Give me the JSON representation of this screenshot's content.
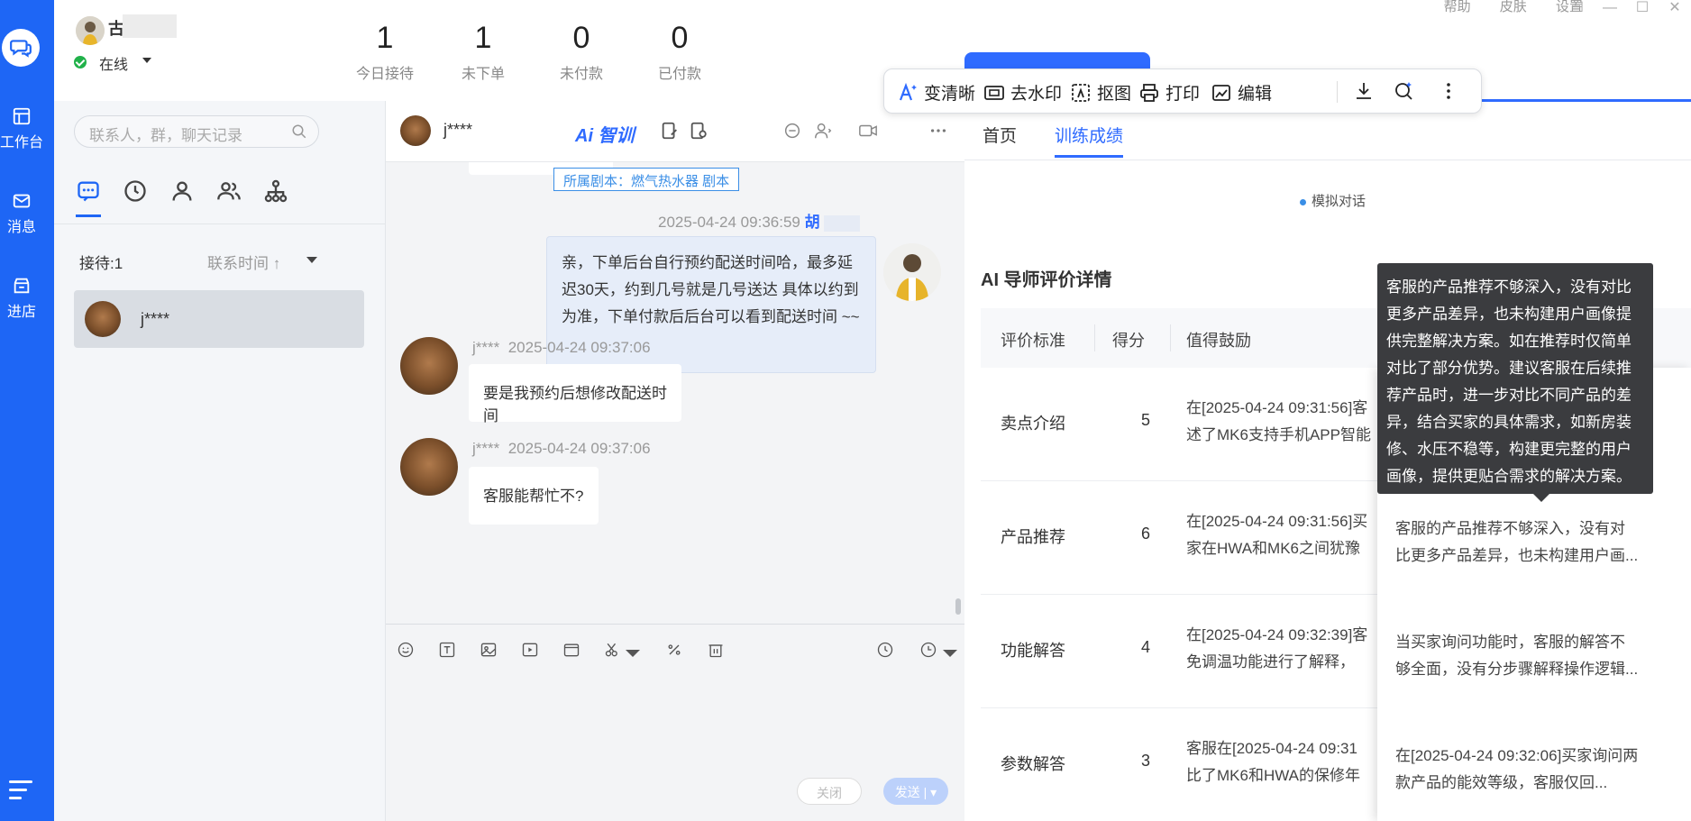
{
  "rail": {
    "items": [
      {
        "label": "工作台"
      },
      {
        "label": "消息"
      },
      {
        "label": "进店"
      }
    ]
  },
  "header": {
    "user_initial": "古",
    "status": "在线",
    "stats": [
      {
        "value": "1",
        "label": "今日接待"
      },
      {
        "value": "1",
        "label": "未下单"
      },
      {
        "value": "0",
        "label": "未付款"
      },
      {
        "value": "0",
        "label": "已付款"
      }
    ],
    "links": [
      "帮助",
      "皮肤",
      "设置"
    ]
  },
  "contacts": {
    "search_placeholder": "联系人，群，聊天记录",
    "queue_label": "接待:1",
    "sort_label": "联系时间 ↑",
    "items": [
      {
        "name": "j****"
      }
    ]
  },
  "chat": {
    "contact_name": "j****",
    "ai_label": "Ai 智训",
    "script_tag": "所属剧本：燃气热水器  剧本",
    "messages": [
      {
        "time": "2025-04-24 09:36:59",
        "sender": "胡",
        "text": "亲，下单后台自行预约配送时间哈，最多延迟30天，约到几号就是几号送达 具体以约到为准，下单付款后后台可以看到配送时间 ~~"
      },
      {
        "sender": "j****",
        "time": "2025-04-24 09:37:06",
        "text": "要是我预约后想修改配送时间"
      },
      {
        "sender": "j****",
        "time": "2025-04-24 09:37:06",
        "text": "客服能帮忙不?"
      }
    ],
    "close_label": "关闭",
    "send_label": "发送 | ▾"
  },
  "float_toolbar": {
    "items": [
      "变清晰",
      "去水印",
      "抠图",
      "打印",
      "编辑"
    ]
  },
  "right_panel": {
    "tabs": [
      "首页",
      "训练成绩"
    ],
    "active_tab": "训练成绩",
    "sim_chip": "模拟对话",
    "eval_title": "AI 导师评价详情",
    "columns": [
      "评价标准",
      "得分",
      "值得鼓励"
    ],
    "rows": [
      {
        "criterion": "卖点介绍",
        "score": "5",
        "praise_1": "在[2025-04-24 09:31:56]客",
        "praise_2": "述了MK6支持手机APP智能",
        "suggestion_1": "",
        "suggestion_2": ""
      },
      {
        "criterion": "产品推荐",
        "score": "6",
        "praise_1": "在[2025-04-24 09:31:56]买",
        "praise_2": "家在HWA和MK6之间犹豫",
        "suggestion_1": "客服的产品推荐不够深入，没有对",
        "suggestion_2": "比更多产品差异，也未构建用户画..."
      },
      {
        "criterion": "功能解答",
        "score": "4",
        "praise_1": "在[2025-04-24 09:32:39]客",
        "praise_2": "免调温功能进行了解释，",
        "suggestion_1": "当买家询问功能时，客服的解答不",
        "suggestion_2": "够全面，没有分步骤解释操作逻辑..."
      },
      {
        "criterion": "参数解答",
        "score": "3",
        "praise_1": "客服在[2025-04-24 09:31",
        "praise_2": "比了MK6和HWA的保修年",
        "suggestion_1": "在[2025-04-24 09:32:06]买家询问两",
        "suggestion_2": "款产品的能效等级，客服仅回..."
      }
    ],
    "tooltip": "客服的产品推荐不够深入，没有对比更多产品差异，也未构建用户画像提供完整解决方案。如在推荐时仅简单对比了部分优势。建议客服在后续推荐产品时，进一步对比不同产品的差异，结合买家的具体需求，如新房装修、水压不稳等，构建更完整的用户画像，提供更贴合需求的解决方案。"
  },
  "colors": {
    "rail": "#1e66f5",
    "accent": "#2f6bff",
    "online": "#21b14a"
  }
}
